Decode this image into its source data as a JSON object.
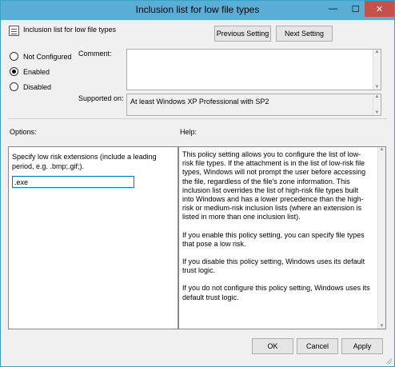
{
  "window": {
    "title": "Inclusion list for low file types",
    "minimize_icon": "minimize-icon",
    "maximize_icon": "maximize-icon",
    "close_icon": "close-icon",
    "minimize_glyph": "—",
    "maximize_glyph": "☐",
    "close_glyph": "✕"
  },
  "header": {
    "policy_icon": "policy-document-icon",
    "policy_name": "Inclusion list for low file types",
    "previous_label": "Previous Setting",
    "next_label": "Next Setting"
  },
  "state": {
    "options": [
      {
        "label": "Not Configured",
        "checked": false
      },
      {
        "label": "Enabled",
        "checked": true
      },
      {
        "label": "Disabled",
        "checked": false
      }
    ]
  },
  "comment": {
    "label": "Comment:",
    "value": ""
  },
  "supported": {
    "label": "Supported on:",
    "value": "At least Windows XP Professional with SP2"
  },
  "options_panel": {
    "label": "Options:",
    "description": "Specify low risk extensions (include a leading period, e.g. .bmp;.gif;).",
    "value": ".exe"
  },
  "help_panel": {
    "label": "Help:",
    "paragraphs": [
      "This policy setting allows you to configure the list of low-risk file types. If the attachment is in the list of low-risk file types, Windows will not prompt the user before accessing the file, regardless of the file's zone information. This inclusion list overrides the list of high-risk file types built into Windows and has a lower precedence than the high-risk or medium-risk inclusion lists (where an extension is listed in more than one inclusion list).",
      "If you enable this policy setting, you can specify file types that pose a low risk.",
      "If you disable this policy setting, Windows uses its default trust logic.",
      "If you do not configure this policy setting, Windows uses its default trust logic."
    ]
  },
  "footer": {
    "ok_label": "OK",
    "cancel_label": "Cancel",
    "apply_label": "Apply"
  },
  "colors": {
    "titlebar": "#5aaed6",
    "close_button": "#c7504b",
    "focus_border": "#0078d7"
  }
}
